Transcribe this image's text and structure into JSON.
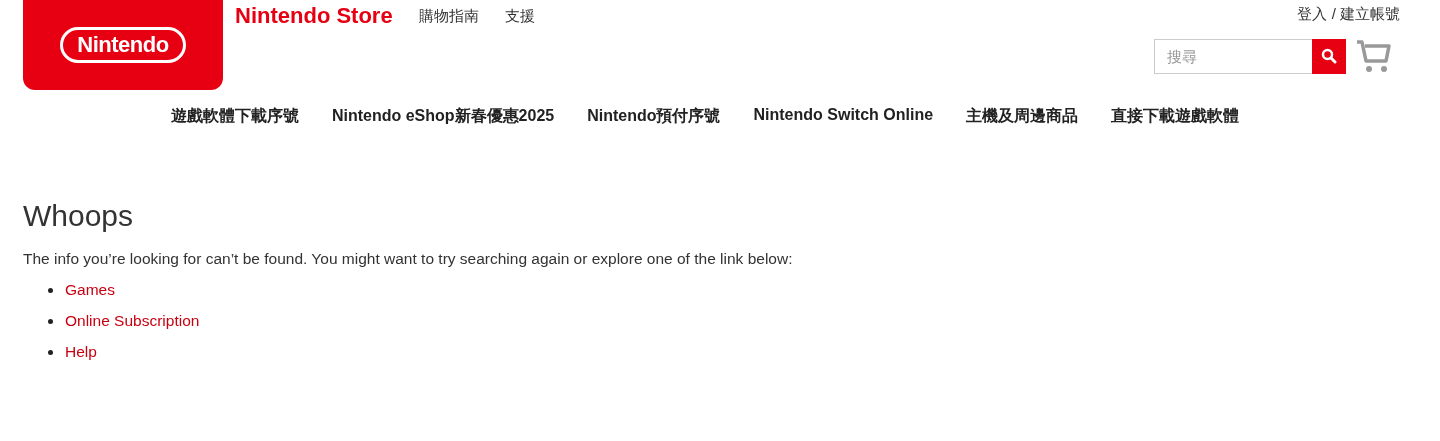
{
  "header": {
    "logo": "Nintendo",
    "store_title": "Nintendo Store",
    "top_links": [
      "購物指南",
      "支援"
    ],
    "account_link": "登入 / 建立帳號",
    "search": {
      "placeholder": "搜尋"
    }
  },
  "nav": [
    "遊戲軟體下載序號",
    "Nintendo eShop新春優惠2025",
    "Nintendo預付序號",
    "Nintendo Switch Online",
    "主機及周邊商品",
    "直接下載遊戲軟體"
  ],
  "content": {
    "title": "Whoops",
    "message": "The info you’re looking for can’t be found. You might want to try searching again or explore one of the link below:",
    "links": [
      "Games",
      "Online Subscription",
      "Help"
    ]
  }
}
